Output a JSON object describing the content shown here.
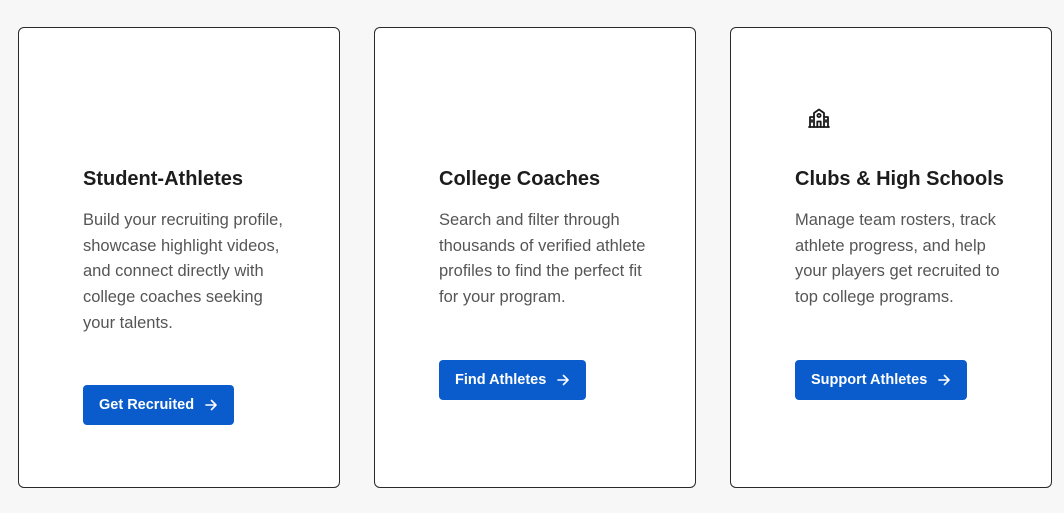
{
  "cards": [
    {
      "title": "Student-Athletes",
      "description": "Build your recruiting profile, showcase highlight videos, and connect directly with college coaches seeking your talents.",
      "button_label": "Get Recruited",
      "icon": "none"
    },
    {
      "title": "College Coaches",
      "description": "Search and filter through thousands of verified athlete profiles to find the perfect fit for your program.",
      "button_label": "Find Athletes",
      "icon": "none"
    },
    {
      "title": "Clubs & High Schools",
      "description": "Manage team rosters, track athlete progress, and help your players get recruited to top college programs.",
      "button_label": "Support Athletes",
      "icon": "school-building-icon"
    }
  ],
  "colors": {
    "page_background": "#f7f7f7",
    "card_background": "#ffffff",
    "card_border": "#2a2a2a",
    "button_background": "#0a5ccc",
    "button_text": "#ffffff",
    "title_text": "#1c1c1c",
    "body_text": "#555555"
  }
}
